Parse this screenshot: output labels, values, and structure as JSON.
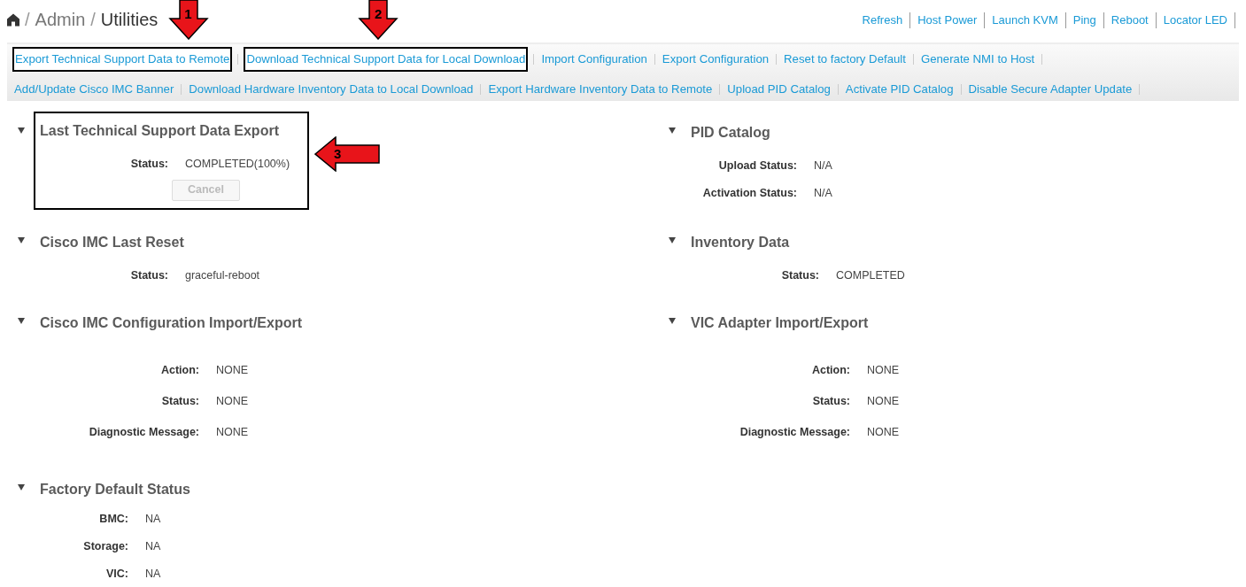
{
  "breadcrumb": {
    "separator": "/",
    "items": [
      "Admin"
    ],
    "current": "Utilities"
  },
  "header_actions": [
    "Refresh",
    "Host Power",
    "Launch KVM",
    "Ping",
    "Reboot",
    "Locator LED"
  ],
  "toolbar": {
    "rows": [
      [
        {
          "label": "Export Technical Support Data to Remote",
          "callout": "1"
        },
        {
          "label": "Download Technical Support Data for Local Download",
          "callout": "2"
        },
        {
          "label": "Import Configuration"
        },
        {
          "label": "Export Configuration"
        },
        {
          "label": "Reset to factory Default"
        },
        {
          "label": "Generate NMI to Host"
        }
      ],
      [
        {
          "label": "Add/Update Cisco IMC Banner"
        },
        {
          "label": "Download Hardware Inventory Data to Local Download"
        },
        {
          "label": "Export Hardware Inventory Data to Remote"
        },
        {
          "label": "Upload PID Catalog"
        },
        {
          "label": "Activate PID Catalog"
        },
        {
          "label": "Disable Secure Adapter Update"
        }
      ]
    ]
  },
  "sections": [
    {
      "title": "Last Technical Support Data Export",
      "callout": "3",
      "expanded": true,
      "fields": [
        {
          "label": "Status:",
          "value": "COMPLETED(100%)"
        }
      ],
      "button": {
        "label": "Cancel",
        "disabled": true
      }
    },
    {
      "title": "PID Catalog",
      "expanded": true,
      "fields": [
        {
          "label": "Upload Status:",
          "value": "N/A"
        },
        {
          "label": "Activation Status:",
          "value": "N/A"
        }
      ]
    },
    {
      "title": "Cisco IMC Last Reset",
      "expanded": true,
      "fields": [
        {
          "label": "Status:",
          "value": "graceful-reboot"
        }
      ]
    },
    {
      "title": "Inventory Data",
      "expanded": true,
      "fields": [
        {
          "label": "Status:",
          "value": "COMPLETED"
        }
      ]
    },
    {
      "title": "Cisco IMC Configuration Import/Export",
      "expanded": true,
      "fields": [
        {
          "label": "Action:",
          "value": "NONE"
        },
        {
          "label": "Status:",
          "value": "NONE"
        },
        {
          "label": "Diagnostic Message:",
          "value": "NONE"
        }
      ]
    },
    {
      "title": "VIC Adapter Import/Export",
      "expanded": true,
      "fields": [
        {
          "label": "Action:",
          "value": "NONE"
        },
        {
          "label": "Status:",
          "value": "NONE"
        },
        {
          "label": "Diagnostic Message:",
          "value": "NONE"
        }
      ]
    },
    {
      "title": "Factory Default Status",
      "expanded": true,
      "fields": [
        {
          "label": "BMC:",
          "value": "NA"
        },
        {
          "label": "Storage:",
          "value": "NA"
        },
        {
          "label": "VIC:",
          "value": "NA"
        }
      ]
    }
  ]
}
